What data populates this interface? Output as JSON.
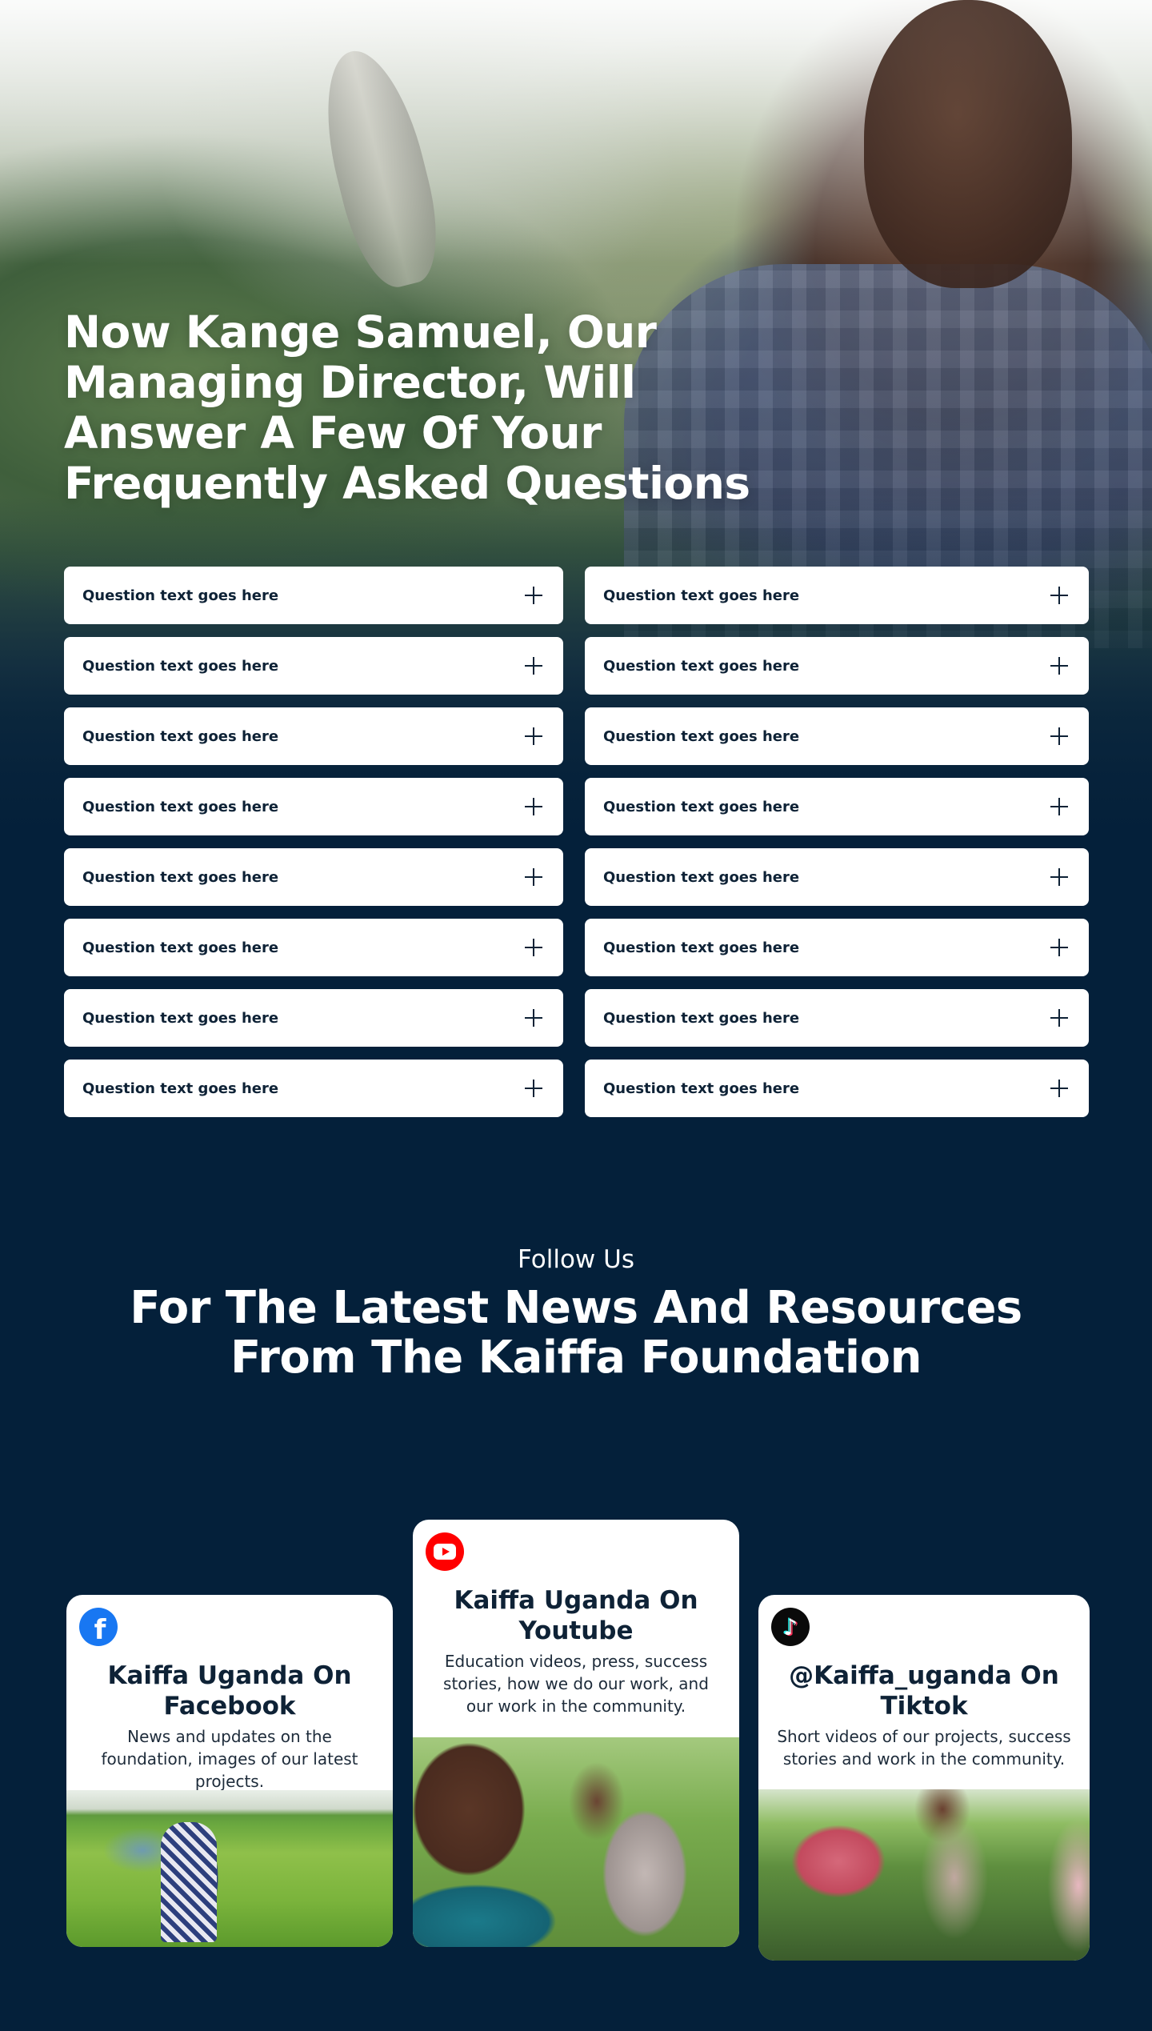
{
  "faq": {
    "title": "Now Kange Samuel, Our Managing Director, Will Answer A Few Of Your Frequently Asked Questions",
    "items_left": [
      "Question text goes here",
      "Question text goes here",
      "Question text goes here",
      "Question text goes here",
      "Question text goes here",
      "Question text goes here",
      "Question text goes here",
      "Question text goes here"
    ],
    "items_right": [
      "Question text goes here",
      "Question text goes here",
      "Question text goes here",
      "Question text goes here",
      "Question text goes here",
      "Question text goes here",
      "Question text goes here",
      "Question text goes here"
    ],
    "toggle_icon": "plus-icon"
  },
  "follow": {
    "eyebrow": "Follow Us",
    "title_line1": "For The Latest News And Resources",
    "title_line2": "From The Kaiffa Foundation"
  },
  "social": {
    "facebook": {
      "icon": "facebook-icon",
      "title": "Kaiffa Uganda On Facebook",
      "description": "News and updates on the foundation, images of our latest projects."
    },
    "youtube": {
      "icon": "youtube-icon",
      "title": "Kaiffa Uganda On Youtube",
      "description": "Education videos, press, success stories, how we do our work, and our work in the community."
    },
    "tiktok": {
      "icon": "tiktok-icon",
      "title": "@Kaiffa_uganda On Tiktok",
      "description": "Short videos of our projects, success stories and work in the community."
    }
  },
  "colors": {
    "background": "#04203a",
    "card": "#ffffff",
    "text_dark": "#0e2236",
    "facebook": "#1877f2",
    "youtube": "#ff0000",
    "tiktok": "#0a0a0a"
  }
}
